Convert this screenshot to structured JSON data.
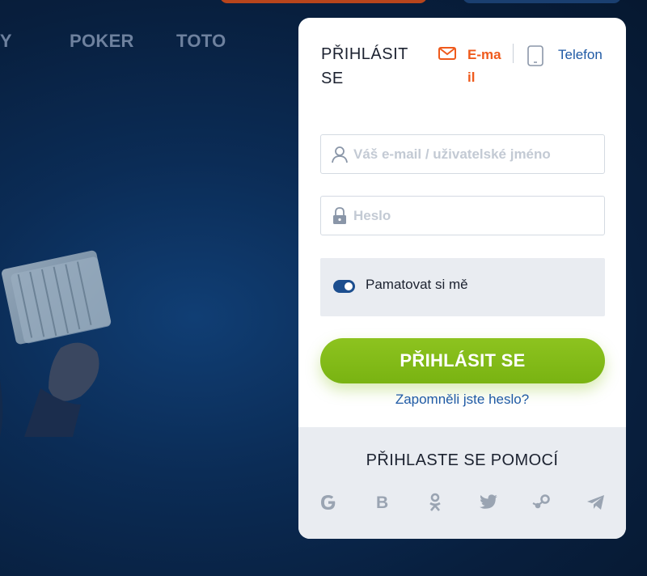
{
  "nav": {
    "items": [
      "RTY",
      "POKER",
      "TOTO"
    ]
  },
  "login": {
    "title": "PŘIHLÁSIT SE",
    "tab_email": "E-mail",
    "tab_phone": "Telefon",
    "username_placeholder": "Váš e-mail / uživatelské jméno",
    "password_placeholder": "Heslo",
    "remember_label": "Pamatovat si mě",
    "remember_checked": true,
    "submit_label": "PŘIHLÁSIT SE",
    "forgot_label": "Zapomněli jste heslo?"
  },
  "social": {
    "title": "PŘIHLASTE SE POMOCÍ",
    "icons": [
      "google-icon",
      "vk-icon",
      "odnoklassniki-icon",
      "twitter-icon",
      "steam-icon",
      "telegram-icon"
    ]
  },
  "colors": {
    "accent_orange": "#ef5a1c",
    "accent_blue": "#1f5aa5",
    "button_green": "#8dc31f",
    "background_navy": "#0b2c56"
  }
}
